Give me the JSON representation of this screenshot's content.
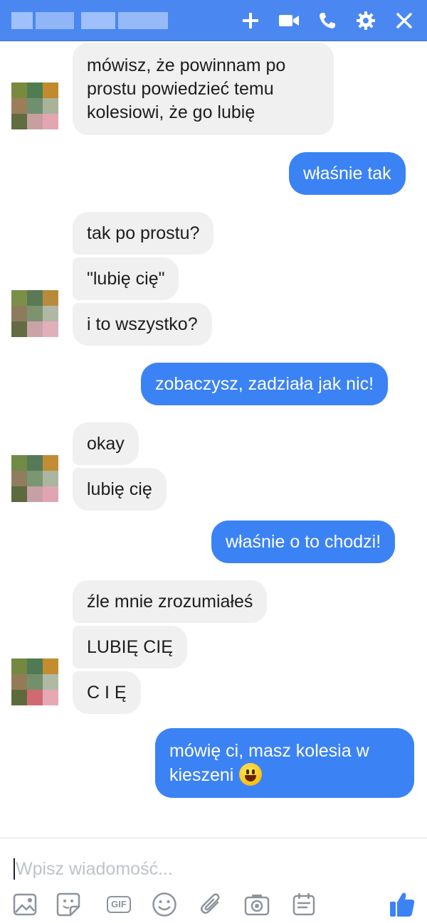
{
  "header": {
    "bg_color": "#4a87f0",
    "icons": [
      "add-icon",
      "video-call-icon",
      "phone-call-icon",
      "settings-gear-icon",
      "close-icon"
    ]
  },
  "messages": [
    {
      "id": "m1",
      "side": "in",
      "text": "mówisz, że powinnam po prostu powiedzieć temu kolesiowi, że go lubię"
    },
    {
      "id": "m2",
      "side": "out",
      "text": "właśnie tak"
    },
    {
      "id": "m3",
      "side": "in",
      "text": "tak po prostu?"
    },
    {
      "id": "m4",
      "side": "in",
      "text": "\"lubię cię\""
    },
    {
      "id": "m5",
      "side": "in",
      "text": "i to wszystko?"
    },
    {
      "id": "m6",
      "side": "out",
      "text": "zobaczysz, zadziała jak nic!"
    },
    {
      "id": "m7",
      "side": "in",
      "text": "okay"
    },
    {
      "id": "m8",
      "side": "in",
      "text": "lubię cię"
    },
    {
      "id": "m9",
      "side": "out",
      "text": "właśnie o to chodzi!"
    },
    {
      "id": "m10",
      "side": "in",
      "text": "źle mnie zrozumiałeś"
    },
    {
      "id": "m11",
      "side": "in",
      "text": "LUBIĘ CIĘ"
    },
    {
      "id": "m12",
      "side": "in",
      "text": "C I Ę"
    },
    {
      "id": "m13",
      "side": "out",
      "text": "mówię ci, masz kolesia w kieszeni",
      "emoji": "grinning-face-emoji"
    }
  ],
  "colors": {
    "incoming_bubble": "#f1f0f0",
    "outgoing_bubble": "#3b82f5",
    "outgoing_text": "#ffffff",
    "incoming_text": "#1d1d1d"
  },
  "composer": {
    "placeholder": "Wpisz wiadomość...",
    "value": "",
    "tools": [
      "image-icon",
      "sticker-icon",
      "gif-icon",
      "emoji-icon",
      "attachment-icon",
      "camera-icon",
      "calendar-icon"
    ],
    "gif_label": "GIF",
    "like_icon": "thumbs-up-icon"
  }
}
